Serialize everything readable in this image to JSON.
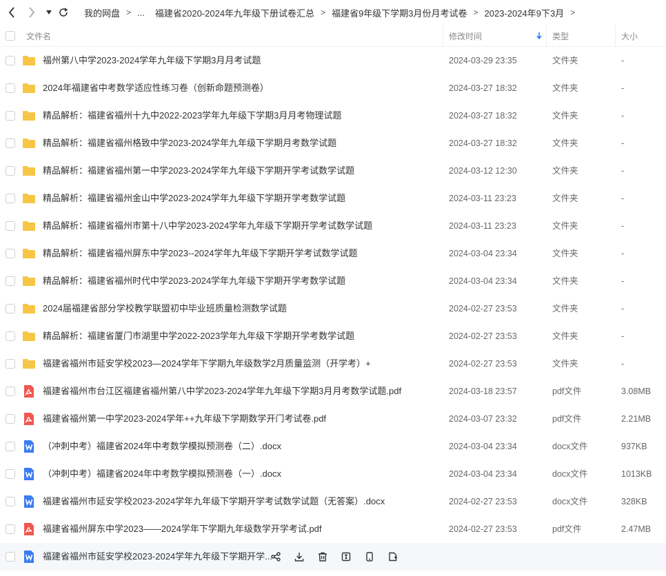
{
  "breadcrumb": {
    "items": [
      "我的网盘",
      "...",
      "福建省2020-2024年九年级下册试卷汇总",
      "福建省9年级下学期3月份月考试卷",
      "2023-2024年9下3月"
    ],
    "separator": ">"
  },
  "columns": {
    "name": "文件名",
    "modified": "修改时间",
    "type": "类型",
    "size": "大小"
  },
  "colors": {
    "folder": "#f7c646",
    "pdf": "#f0574f",
    "docx": "#3b7cf0",
    "sort_arrow": "#2f7cf6",
    "hover_row": "#f5f7fa"
  },
  "files": [
    {
      "name": "福州第八中学2023-2024学年九年级下学期3月月考试题",
      "date": "2024-03-29 23:35",
      "type": "文件夹",
      "size": "-",
      "icon": "folder"
    },
    {
      "name": "2024年福建省中考数学适应性练习卷（创新命题预测卷）",
      "date": "2024-03-27 18:32",
      "type": "文件夹",
      "size": "-",
      "icon": "folder"
    },
    {
      "name": "精品解析：福建省福州十九中2022-2023学年九年级下学期3月月考物理试题",
      "date": "2024-03-27 18:32",
      "type": "文件夹",
      "size": "-",
      "icon": "folder"
    },
    {
      "name": "精品解析：福建省福州格致中学2023-2024学年九年级下学期月考数学试题",
      "date": "2024-03-27 18:32",
      "type": "文件夹",
      "size": "-",
      "icon": "folder"
    },
    {
      "name": "精品解析：福建省福州第一中学2023-2024学年九年级下学期开学考试数学试题",
      "date": "2024-03-12 12:30",
      "type": "文件夹",
      "size": "-",
      "icon": "folder"
    },
    {
      "name": "精品解析：福建省福州金山中学2023-2024学年九年级下学期开学考数学试题",
      "date": "2024-03-11 23:23",
      "type": "文件夹",
      "size": "-",
      "icon": "folder"
    },
    {
      "name": "精品解析：福建省福州市第十八中学2023-2024学年九年级下学期开学考试数学试题",
      "date": "2024-03-11 23:23",
      "type": "文件夹",
      "size": "-",
      "icon": "folder"
    },
    {
      "name": "精品解析：福建省福州屏东中学2023--2024学年九年级下学期开学考试数学试题",
      "date": "2024-03-04 23:34",
      "type": "文件夹",
      "size": "-",
      "icon": "folder"
    },
    {
      "name": "精品解析：福建省福州时代中学2023-2024学年九年级下学期开学考数学试题",
      "date": "2024-03-04 23:34",
      "type": "文件夹",
      "size": "-",
      "icon": "folder"
    },
    {
      "name": "2024届福建省部分学校教学联盟初中毕业班质量检测数学试题",
      "date": "2024-02-27 23:53",
      "type": "文件夹",
      "size": "-",
      "icon": "folder"
    },
    {
      "name": "精品解析：福建省厦门市湖里中学2022-2023学年九年级下学期开学考数学试题",
      "date": "2024-02-27 23:53",
      "type": "文件夹",
      "size": "-",
      "icon": "folder"
    },
    {
      "name": "福建省福州市延安学校2023—2024学年下学期九年级数学2月质量监测（开学考）+",
      "date": "2024-02-27 23:53",
      "type": "文件夹",
      "size": "-",
      "icon": "folder"
    },
    {
      "name": "福建省福州市台江区福建省福州第八中学2023-2024学年九年级下学期3月月考数学试题.pdf",
      "date": "2024-03-18 23:57",
      "type": "pdf文件",
      "size": "3.08MB",
      "icon": "pdf"
    },
    {
      "name": "福建省福州第一中学2023-2024学年++九年级下学期数学开门考试卷.pdf",
      "date": "2024-03-07 23:32",
      "type": "pdf文件",
      "size": "2.21MB",
      "icon": "pdf"
    },
    {
      "name": "（冲刺中考）福建省2024年中考数学模拟预测卷（二）.docx",
      "date": "2024-03-04 23:34",
      "type": "docx文件",
      "size": "937KB",
      "icon": "docx"
    },
    {
      "name": "（冲刺中考）福建省2024年中考数学模拟预测卷（一）.docx",
      "date": "2024-03-04 23:34",
      "type": "docx文件",
      "size": "1013KB",
      "icon": "docx"
    },
    {
      "name": "福建省福州市延安学校2023-2024学年九年级下学期开学考试数学试题（无答案）.docx",
      "date": "2024-02-27 23:53",
      "type": "docx文件",
      "size": "328KB",
      "icon": "docx"
    },
    {
      "name": "福建省福州屏东中学2023——2024学年下学期九年级数学开学考试.pdf",
      "date": "2024-02-27 23:53",
      "type": "pdf文件",
      "size": "2.47MB",
      "icon": "pdf"
    },
    {
      "name": "福建省福州市延安学校2023-2024学年九年级下学期开学...",
      "date": "",
      "type": "",
      "size": "",
      "icon": "docx"
    }
  ],
  "hover_actions": [
    "share-icon",
    "download-icon",
    "delete-icon",
    "rename-icon",
    "phone-icon",
    "copy-icon"
  ]
}
